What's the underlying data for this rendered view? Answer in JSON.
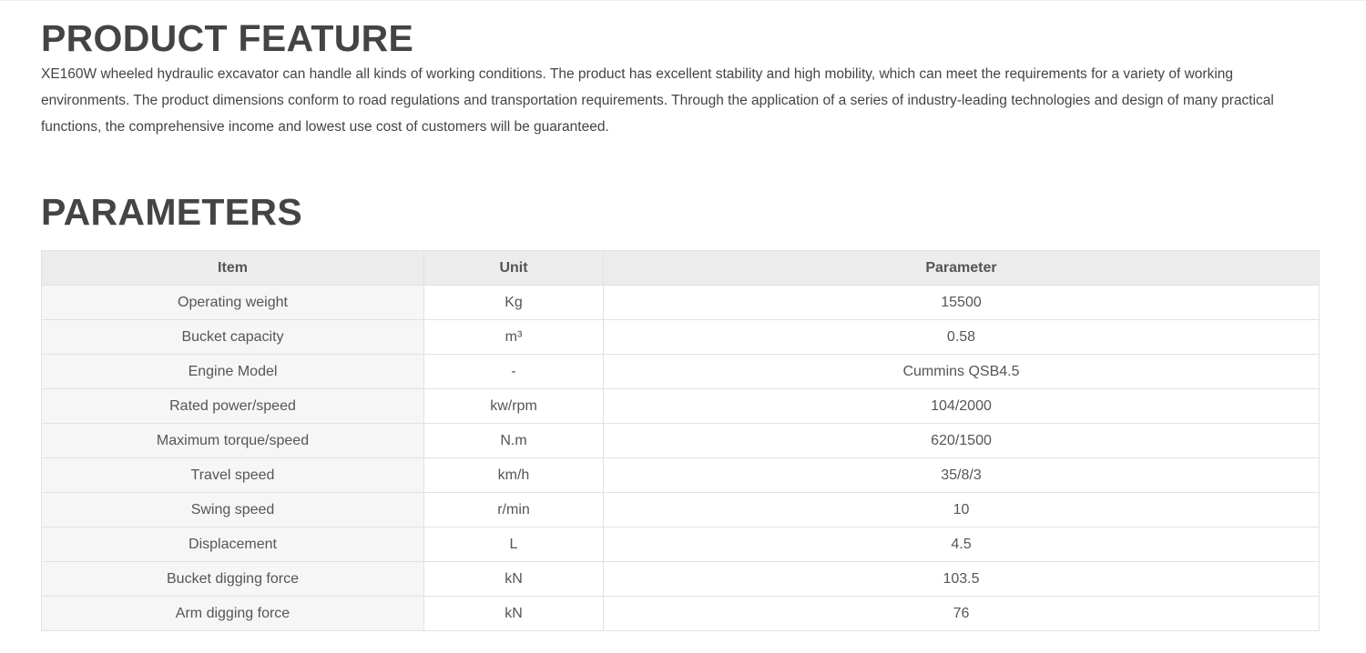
{
  "feature": {
    "title": "PRODUCT FEATURE",
    "description": "XE160W wheeled hydraulic excavator can handle all kinds of working conditions. The product has excellent stability and high mobility, which can meet the requirements for a variety of working environments. The product dimensions conform to road regulations and transportation requirements. Through the application of a series of industry-leading technologies and design of many practical functions, the comprehensive income and lowest use cost of customers will be guaranteed."
  },
  "parameters": {
    "title": "PARAMETERS",
    "headers": {
      "item": "Item",
      "unit": "Unit",
      "parameter": "Parameter"
    },
    "rows": [
      {
        "item": "Operating weight",
        "unit": "Kg",
        "value": "15500"
      },
      {
        "item": "Bucket capacity",
        "unit": "m³",
        "value": "0.58"
      },
      {
        "item": "Engine Model",
        "unit": "-",
        "value": "Cummins QSB4.5"
      },
      {
        "item": "Rated power/speed",
        "unit": "kw/rpm",
        "value": "104/2000"
      },
      {
        "item": "Maximum torque/speed",
        "unit": "N.m",
        "value": "620/1500"
      },
      {
        "item": "Travel speed",
        "unit": "km/h",
        "value": "35/8/3"
      },
      {
        "item": "Swing speed",
        "unit": "r/min",
        "value": "10"
      },
      {
        "item": "Displacement",
        "unit": "L",
        "value": "4.5"
      },
      {
        "item": "Bucket digging force",
        "unit": "kN",
        "value": "103.5"
      },
      {
        "item": "Arm digging force",
        "unit": "kN",
        "value": "76"
      }
    ]
  }
}
